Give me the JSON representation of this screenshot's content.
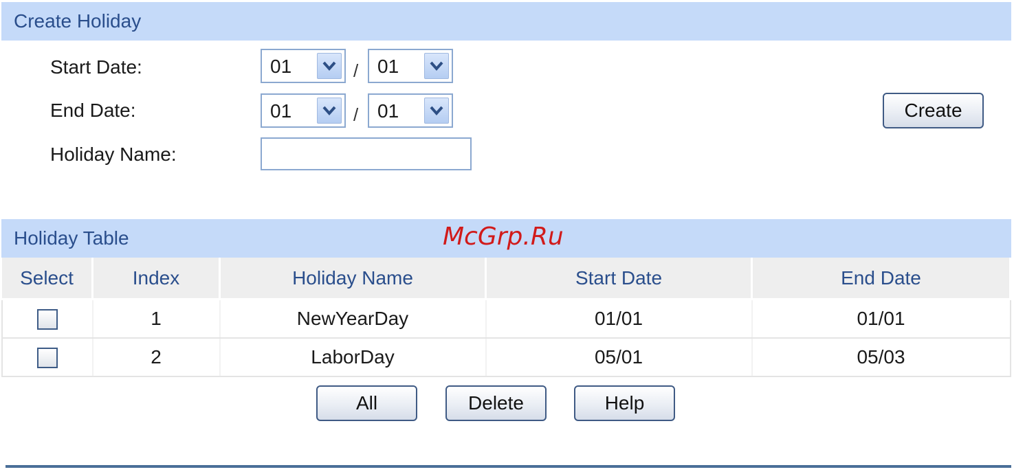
{
  "create_holiday": {
    "title": "Create Holiday",
    "start_date_label": "Start Date:",
    "end_date_label": "End Date:",
    "holiday_name_label": "Holiday Name:",
    "start_month": "01",
    "start_day": "01",
    "end_month": "01",
    "end_day": "01",
    "separator": "/",
    "holiday_name_value": "",
    "create_button": "Create"
  },
  "holiday_table": {
    "title": "Holiday Table",
    "headers": [
      "Select",
      "Index",
      "Holiday Name",
      "Start Date",
      "End Date"
    ],
    "rows": [
      {
        "index": "1",
        "name": "NewYearDay",
        "start": "01/01",
        "end": "01/01"
      },
      {
        "index": "2",
        "name": "LaborDay",
        "start": "05/01",
        "end": "05/03"
      }
    ]
  },
  "buttons": {
    "all": "All",
    "delete": "Delete",
    "help": "Help"
  },
  "watermark": "McGrp.Ru",
  "colors": {
    "section_bar": "#c5daf9",
    "section_text": "#2a4e8c",
    "watermark": "#d11a1a"
  }
}
